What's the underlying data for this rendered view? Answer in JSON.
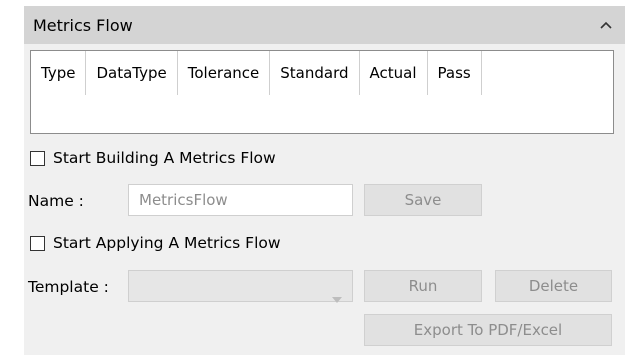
{
  "panel": {
    "title": "Metrics Flow",
    "collapse_icon": "chevron-up-icon"
  },
  "table": {
    "columns": [
      "Type",
      "DataType",
      "Tolerance",
      "Standard",
      "Actual",
      "Pass"
    ]
  },
  "build": {
    "checkbox_label": "Start Building A Metrics Flow",
    "name_label": "Name :",
    "name_value": "MetricsFlow",
    "save_label": "Save"
  },
  "apply": {
    "checkbox_label": "Start Applying A Metrics Flow",
    "template_label": "Template :",
    "template_value": "",
    "run_label": "Run",
    "delete_label": "Delete",
    "export_label": "Export To PDF/Excel"
  }
}
